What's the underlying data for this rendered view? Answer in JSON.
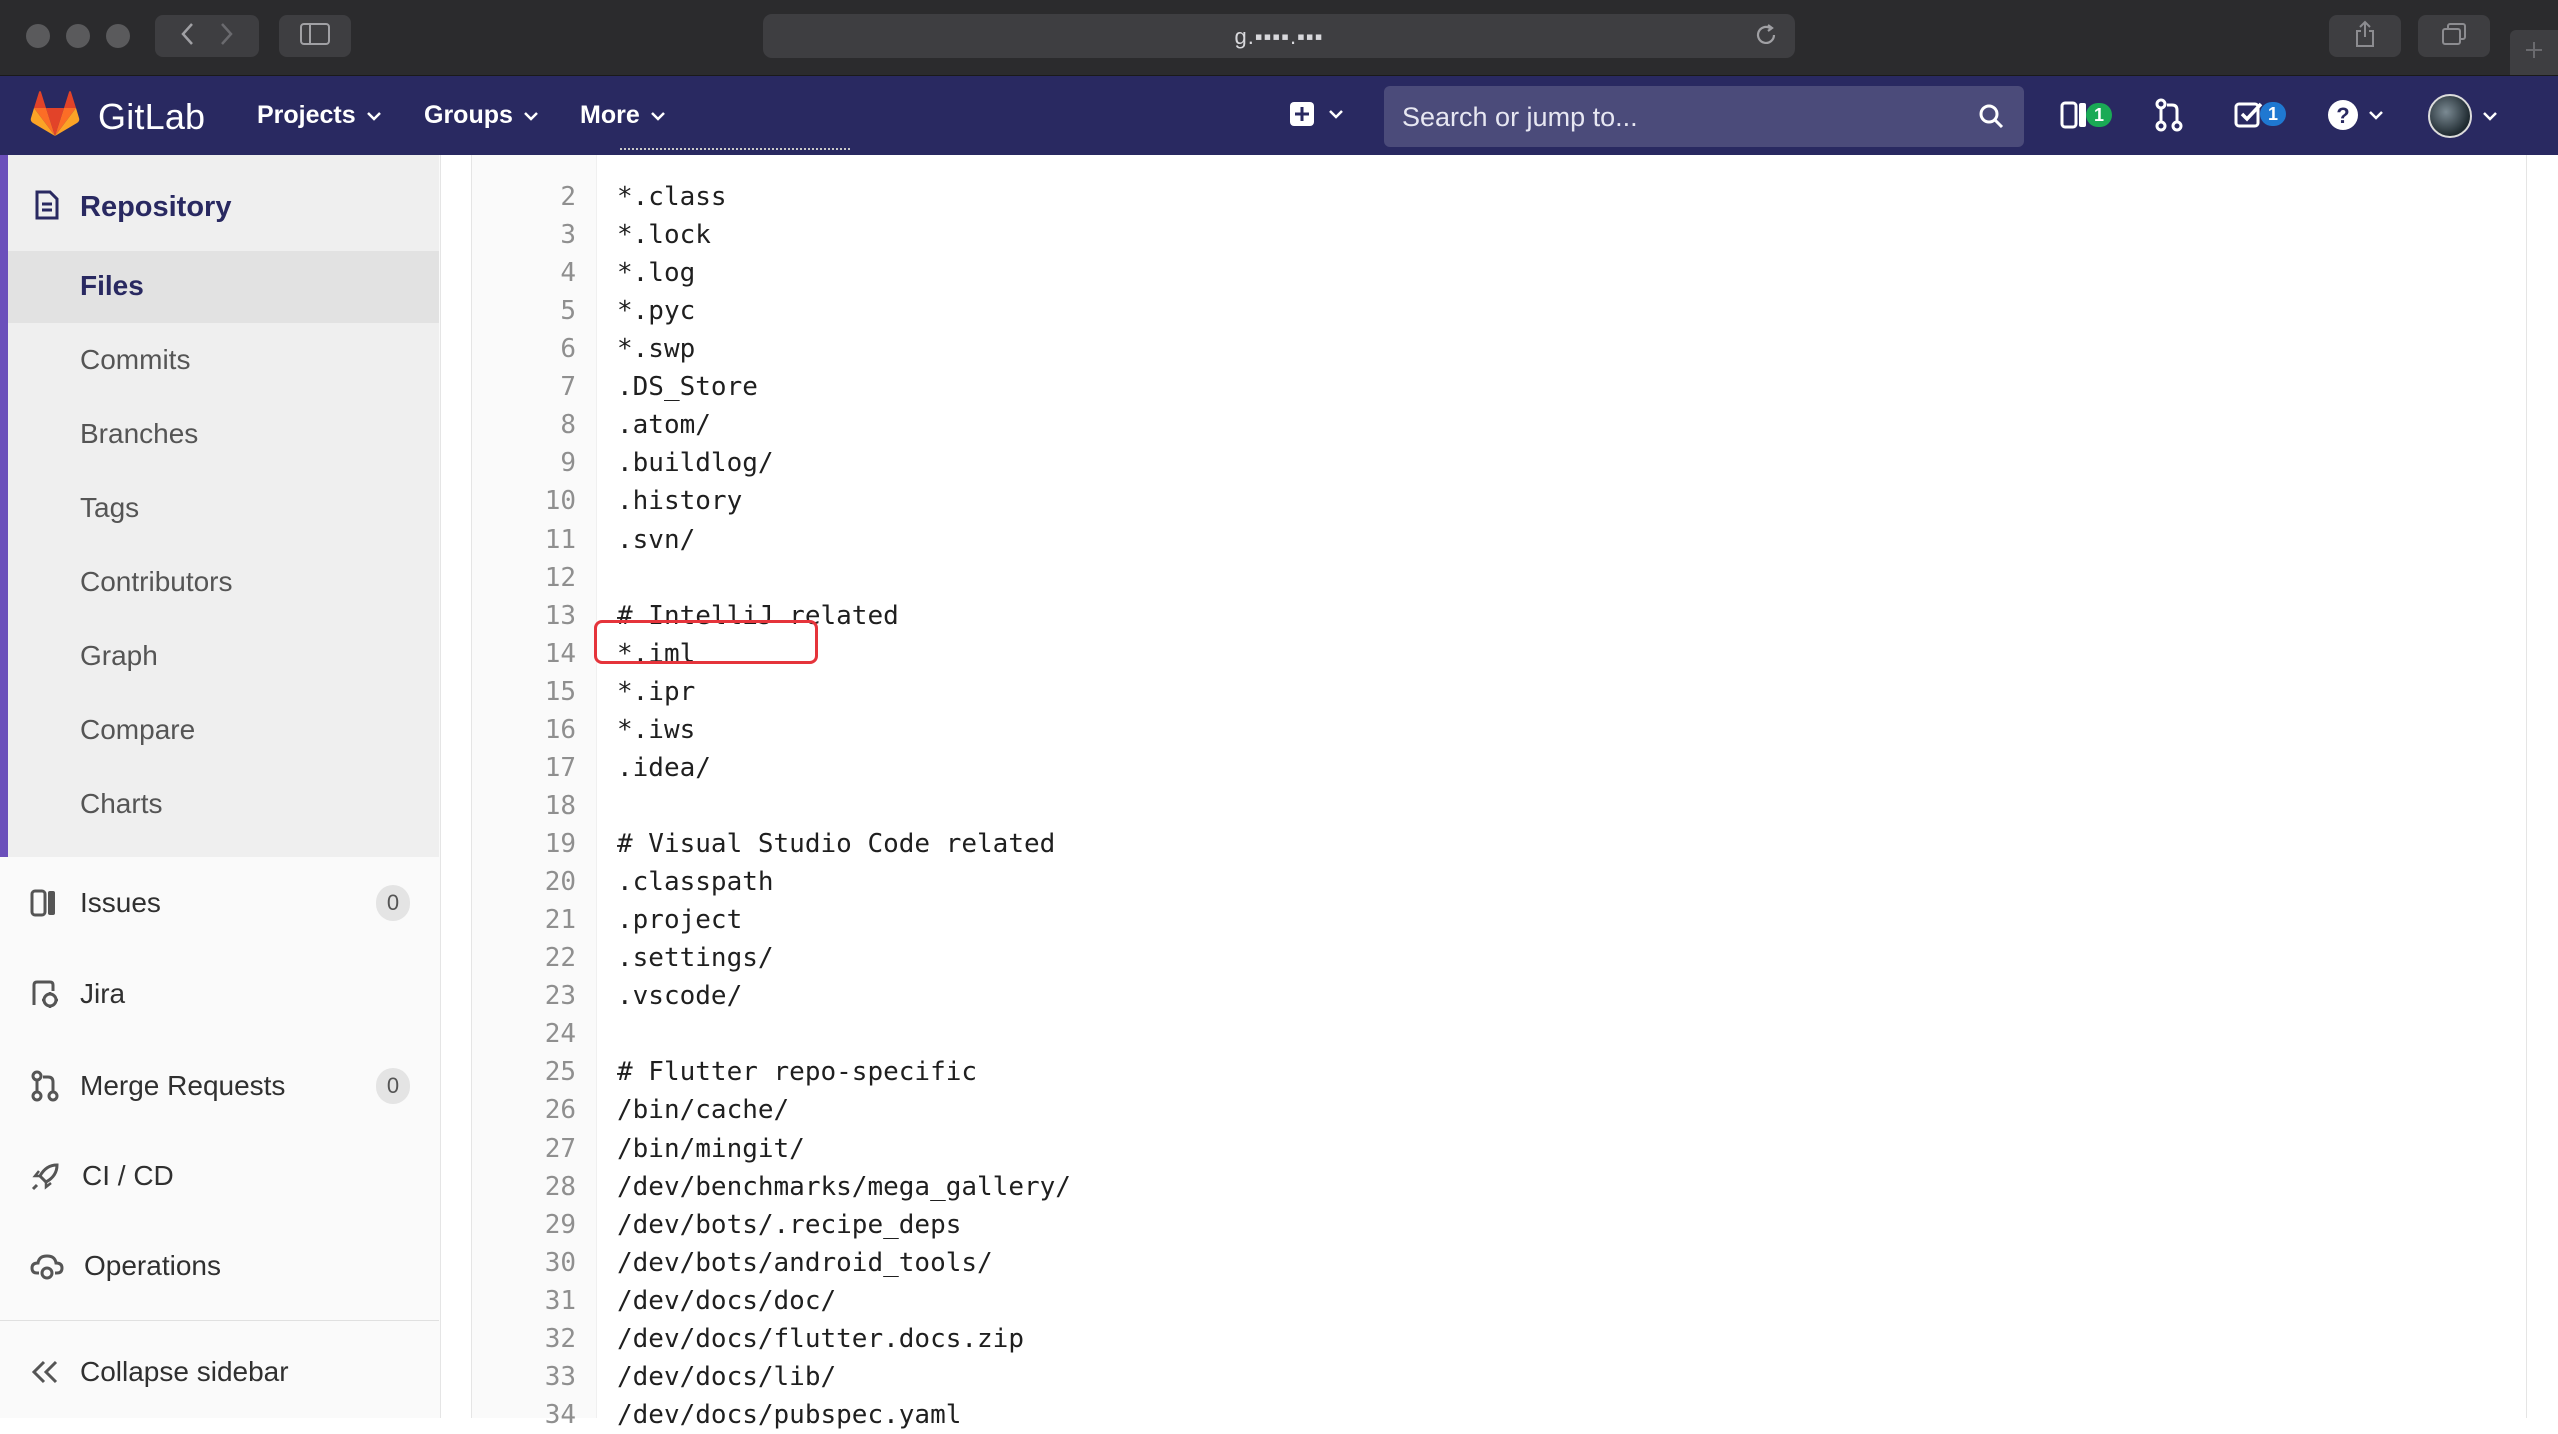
{
  "browser": {
    "url_text": "g.▪▪▪▪.▪▪▪",
    "controls": [
      "back",
      "forward",
      "sidebar",
      "reload",
      "share",
      "tabs",
      "new-tab"
    ]
  },
  "header": {
    "brand": "GitLab",
    "nav": {
      "projects": "Projects",
      "groups": "Groups",
      "more": "More"
    },
    "search_placeholder": "Search or jump to...",
    "issues_badge": "1",
    "todos_badge": "1",
    "colors": {
      "header_bg": "#292961",
      "issues_badge": "#1aaa55",
      "todos_badge": "#1f78d1"
    }
  },
  "sidebar": {
    "repository": "Repository",
    "sub_items": [
      {
        "label": "Files",
        "active": true
      },
      {
        "label": "Commits",
        "active": false
      },
      {
        "label": "Branches",
        "active": false
      },
      {
        "label": "Tags",
        "active": false
      },
      {
        "label": "Contributors",
        "active": false
      },
      {
        "label": "Graph",
        "active": false
      },
      {
        "label": "Compare",
        "active": false
      },
      {
        "label": "Charts",
        "active": false
      }
    ],
    "issues": {
      "label": "Issues",
      "count": "0"
    },
    "jira": {
      "label": "Jira"
    },
    "merge_requests": {
      "label": "Merge Requests",
      "count": "0"
    },
    "ci_cd": {
      "label": "CI / CD"
    },
    "operations": {
      "label": "Operations"
    },
    "collapse": "Collapse sidebar"
  },
  "file": {
    "highlighted_line": "14",
    "lines": [
      {
        "n": "2",
        "t": "*.class"
      },
      {
        "n": "3",
        "t": "*.lock"
      },
      {
        "n": "4",
        "t": "*.log"
      },
      {
        "n": "5",
        "t": "*.pyc"
      },
      {
        "n": "6",
        "t": "*.swp"
      },
      {
        "n": "7",
        "t": ".DS_Store"
      },
      {
        "n": "8",
        "t": ".atom/"
      },
      {
        "n": "9",
        "t": ".buildlog/"
      },
      {
        "n": "10",
        "t": ".history"
      },
      {
        "n": "11",
        "t": ".svn/"
      },
      {
        "n": "12",
        "t": ""
      },
      {
        "n": "13",
        "t": "# IntelliJ related"
      },
      {
        "n": "14",
        "t": "*.iml"
      },
      {
        "n": "15",
        "t": "*.ipr"
      },
      {
        "n": "16",
        "t": "*.iws"
      },
      {
        "n": "17",
        "t": ".idea/"
      },
      {
        "n": "18",
        "t": ""
      },
      {
        "n": "19",
        "t": "# Visual Studio Code related"
      },
      {
        "n": "20",
        "t": ".classpath"
      },
      {
        "n": "21",
        "t": ".project"
      },
      {
        "n": "22",
        "t": ".settings/"
      },
      {
        "n": "23",
        "t": ".vscode/"
      },
      {
        "n": "24",
        "t": ""
      },
      {
        "n": "25",
        "t": "# Flutter repo-specific"
      },
      {
        "n": "26",
        "t": "/bin/cache/"
      },
      {
        "n": "27",
        "t": "/bin/mingit/"
      },
      {
        "n": "28",
        "t": "/dev/benchmarks/mega_gallery/"
      },
      {
        "n": "29",
        "t": "/dev/bots/.recipe_deps"
      },
      {
        "n": "30",
        "t": "/dev/bots/android_tools/"
      },
      {
        "n": "31",
        "t": "/dev/docs/doc/"
      },
      {
        "n": "32",
        "t": "/dev/docs/flutter.docs.zip"
      },
      {
        "n": "33",
        "t": "/dev/docs/lib/"
      },
      {
        "n": "34",
        "t": "/dev/docs/pubspec.yaml"
      }
    ]
  }
}
